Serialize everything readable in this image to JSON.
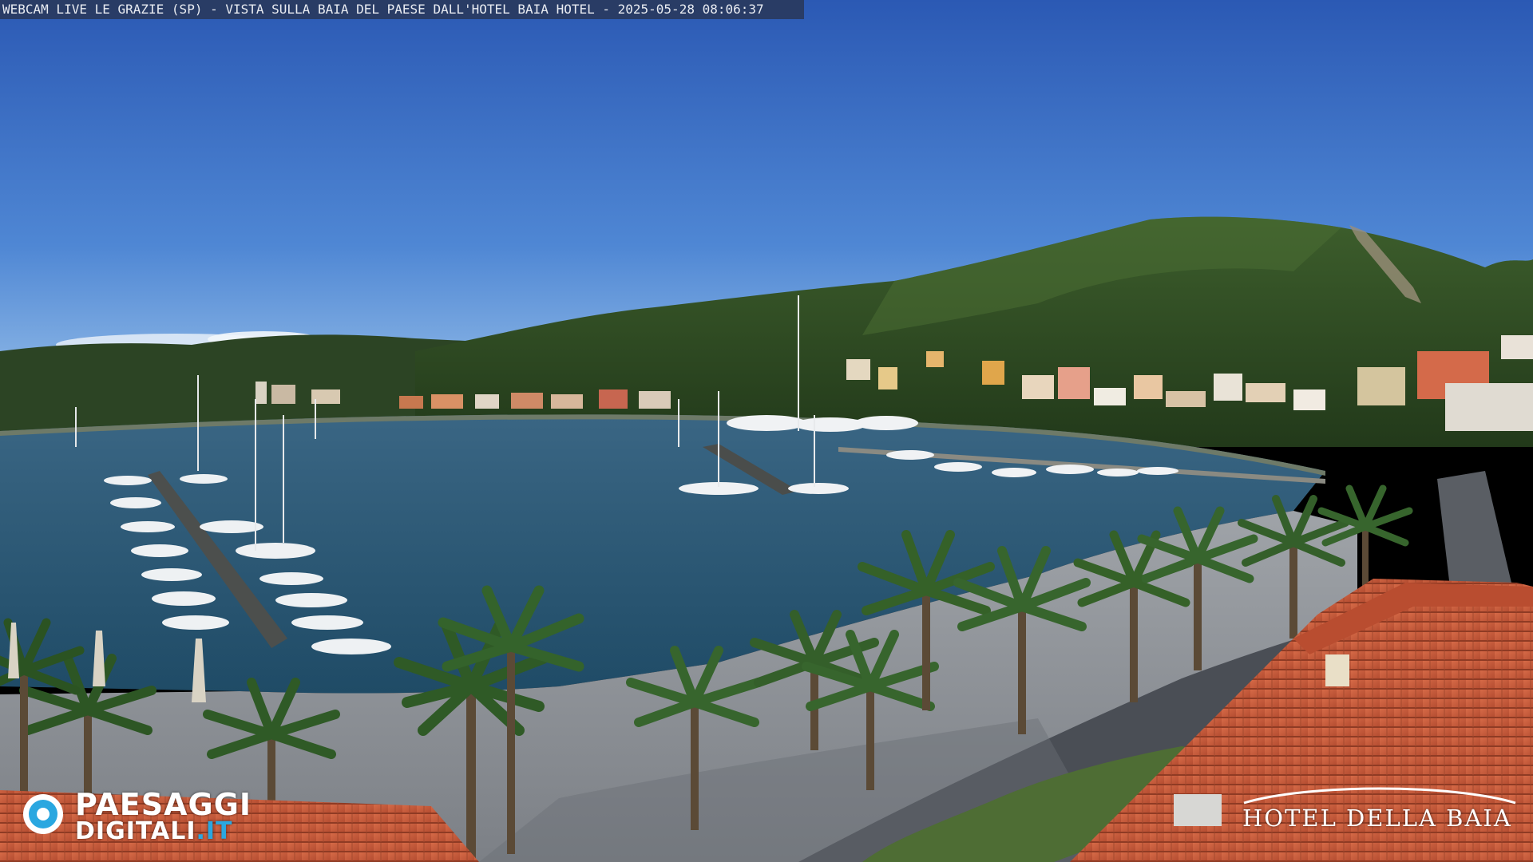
{
  "overlay": {
    "caption": "WEBCAM LIVE LE GRAZIE (SP) - VISTA SULLA BAIA DEL PAESE DALL'HOTEL BAIA HOTEL - 2025-05-28 08:06:37"
  },
  "watermark_left": {
    "line1": "PAESAGGI",
    "line2_main": "DIGITALI",
    "line2_tld": ".IT"
  },
  "watermark_right": {
    "name": "HOTEL DELLA BAIA"
  },
  "colors": {
    "sky_top": "#2f5fb8",
    "sky_horizon": "#9cc4ea",
    "sea": "#2b5a78",
    "hill": "#2e4a22",
    "roof": "#c8583a",
    "promenade": "#8d9196",
    "brand_blue": "#2aa7e0"
  }
}
